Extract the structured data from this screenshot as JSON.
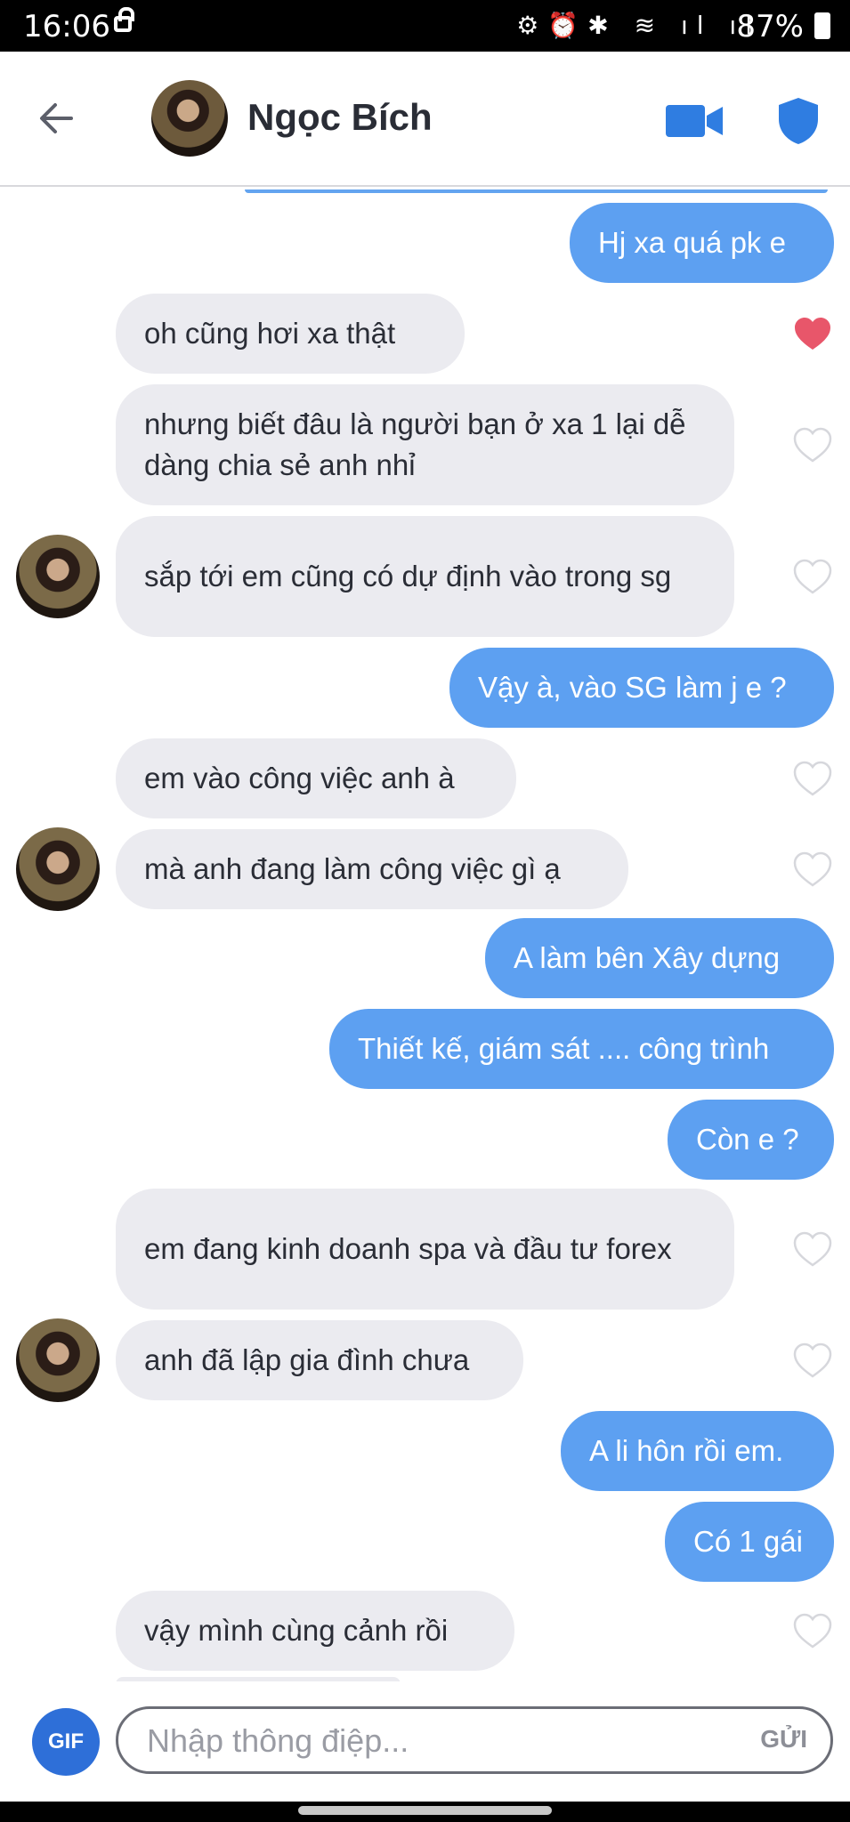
{
  "status_bar": {
    "time": "16:06",
    "battery": "87%"
  },
  "header": {
    "contact_name": "Ngọc Bích"
  },
  "messages": [
    {
      "side": "out",
      "text": "Hj xa quá pk e"
    },
    {
      "side": "in",
      "text": "oh  cũng hơi xa thật",
      "liked": true
    },
    {
      "side": "in",
      "text": "nhưng biết đâu là người bạn ở xa 1 lại dễ dàng chia sẻ anh nhỉ",
      "liked": false
    },
    {
      "side": "in",
      "text": "sắp tới em cũng có dự định vào trong sg",
      "liked": false,
      "avatar": true
    },
    {
      "side": "out",
      "text": "Vậy à, vào SG làm j e ?"
    },
    {
      "side": "in",
      "text": "em vào công việc anh à",
      "liked": false
    },
    {
      "side": "in",
      "text": "mà anh đang làm công việc gì ạ",
      "liked": false,
      "avatar": true
    },
    {
      "side": "out",
      "text": "A làm bên Xây dựng"
    },
    {
      "side": "out",
      "text": "Thiết kế, giám sát .... công trình"
    },
    {
      "side": "out",
      "text": "Còn e ?"
    },
    {
      "side": "in",
      "text": "em đang kinh doanh spa và đầu tư forex",
      "liked": false
    },
    {
      "side": "in",
      "text": "anh đã lập gia đình chưa",
      "liked": false,
      "avatar": true
    },
    {
      "side": "out",
      "text": "A li hôn rồi em."
    },
    {
      "side": "out",
      "text": "Có 1 gái"
    },
    {
      "side": "in",
      "text": "vậy mình cùng cảnh rồi",
      "liked": false
    }
  ],
  "composer": {
    "gif_label": "GIF",
    "placeholder": "Nhập thông điệp...",
    "send_label": "GỬI"
  },
  "colors": {
    "outgoing": "#5da0f1",
    "incoming": "#ebebf0",
    "liked_heart": "#e8566a"
  }
}
